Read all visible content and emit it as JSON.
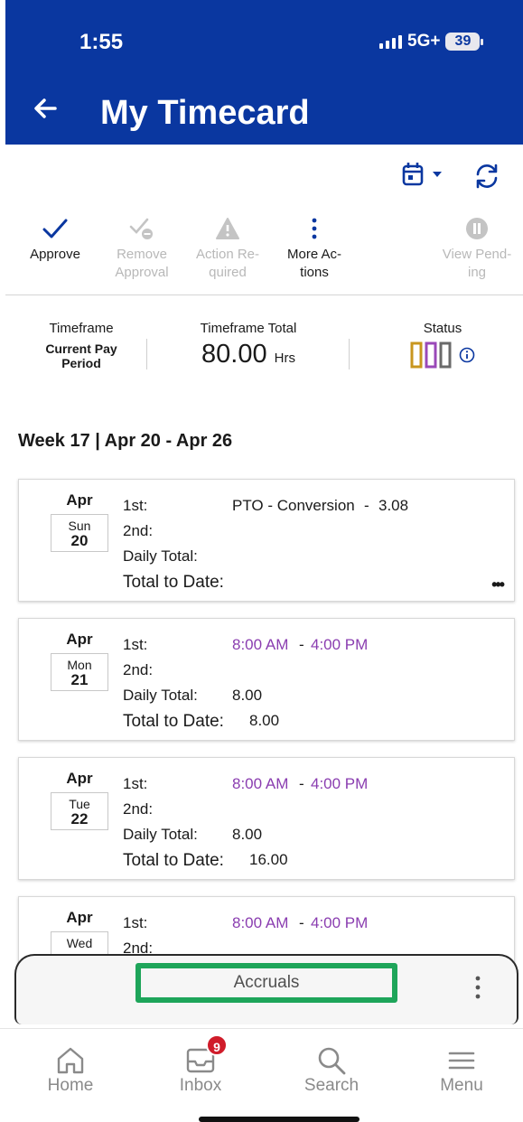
{
  "status_bar": {
    "time": "1:55",
    "network": "5G+",
    "battery": "39"
  },
  "header": {
    "title": "My Timecard"
  },
  "toolbar": {
    "icons": [
      "calendar-icon",
      "refresh-icon"
    ]
  },
  "actions": [
    {
      "label": "Approve",
      "icon": "checkmark-icon",
      "enabled": true
    },
    {
      "label": "Remove\nApproval",
      "icon": "remove-approval-icon",
      "enabled": false
    },
    {
      "label": "Action Re-\nquired",
      "icon": "warning-icon",
      "enabled": false
    },
    {
      "label": "More Ac-\ntions",
      "icon": "more-vertical-icon",
      "enabled": true
    },
    {
      "label": "View Pend-\ning",
      "icon": "pause-icon",
      "enabled": false
    }
  ],
  "summary": {
    "timeframe_label": "Timeframe",
    "timeframe_value": "Current Pay Period",
    "total_label": "Timeframe Total",
    "total_value": "80.00",
    "total_unit": "Hrs",
    "status_label": "Status",
    "status_colors": [
      "#c8961e",
      "#9a48b8",
      "#6a6a6a"
    ]
  },
  "week": {
    "title": "Week 17 | Apr 20 - Apr 26"
  },
  "labels": {
    "first": "1st:",
    "second": "2nd:",
    "daily_total": "Daily Total:",
    "total_to_date": "Total to Date:",
    "dash": "-"
  },
  "days": [
    {
      "month": "Apr",
      "dow": "Sun",
      "day": "20",
      "first_label": "PTO - Conversion",
      "first_value": "3.08",
      "daily_total": "",
      "total_to_date": ""
    },
    {
      "month": "Apr",
      "dow": "Mon",
      "day": "21",
      "first_start": "8:00 AM",
      "first_end": "4:00 PM",
      "daily_total": "8.00",
      "total_to_date": "8.00"
    },
    {
      "month": "Apr",
      "dow": "Tue",
      "day": "22",
      "first_start": "8:00 AM",
      "first_end": "4:00 PM",
      "daily_total": "8.00",
      "total_to_date": "16.00"
    },
    {
      "month": "Apr",
      "dow": "Wed",
      "day": "",
      "first_start": "8:00 AM",
      "first_end": "4:00 PM"
    }
  ],
  "accruals": {
    "label": "Accruals"
  },
  "nav": {
    "items": [
      {
        "label": "Home",
        "icon": "home-icon"
      },
      {
        "label": "Inbox",
        "icon": "inbox-icon",
        "badge": "9"
      },
      {
        "label": "Search",
        "icon": "search-icon"
      },
      {
        "label": "Menu",
        "icon": "menu-icon"
      }
    ]
  },
  "colors": {
    "header_bg": "#0a37a0",
    "accent_purple": "#8a3db0",
    "highlight_green": "#1ea55a",
    "badge_red": "#d01c2a"
  }
}
